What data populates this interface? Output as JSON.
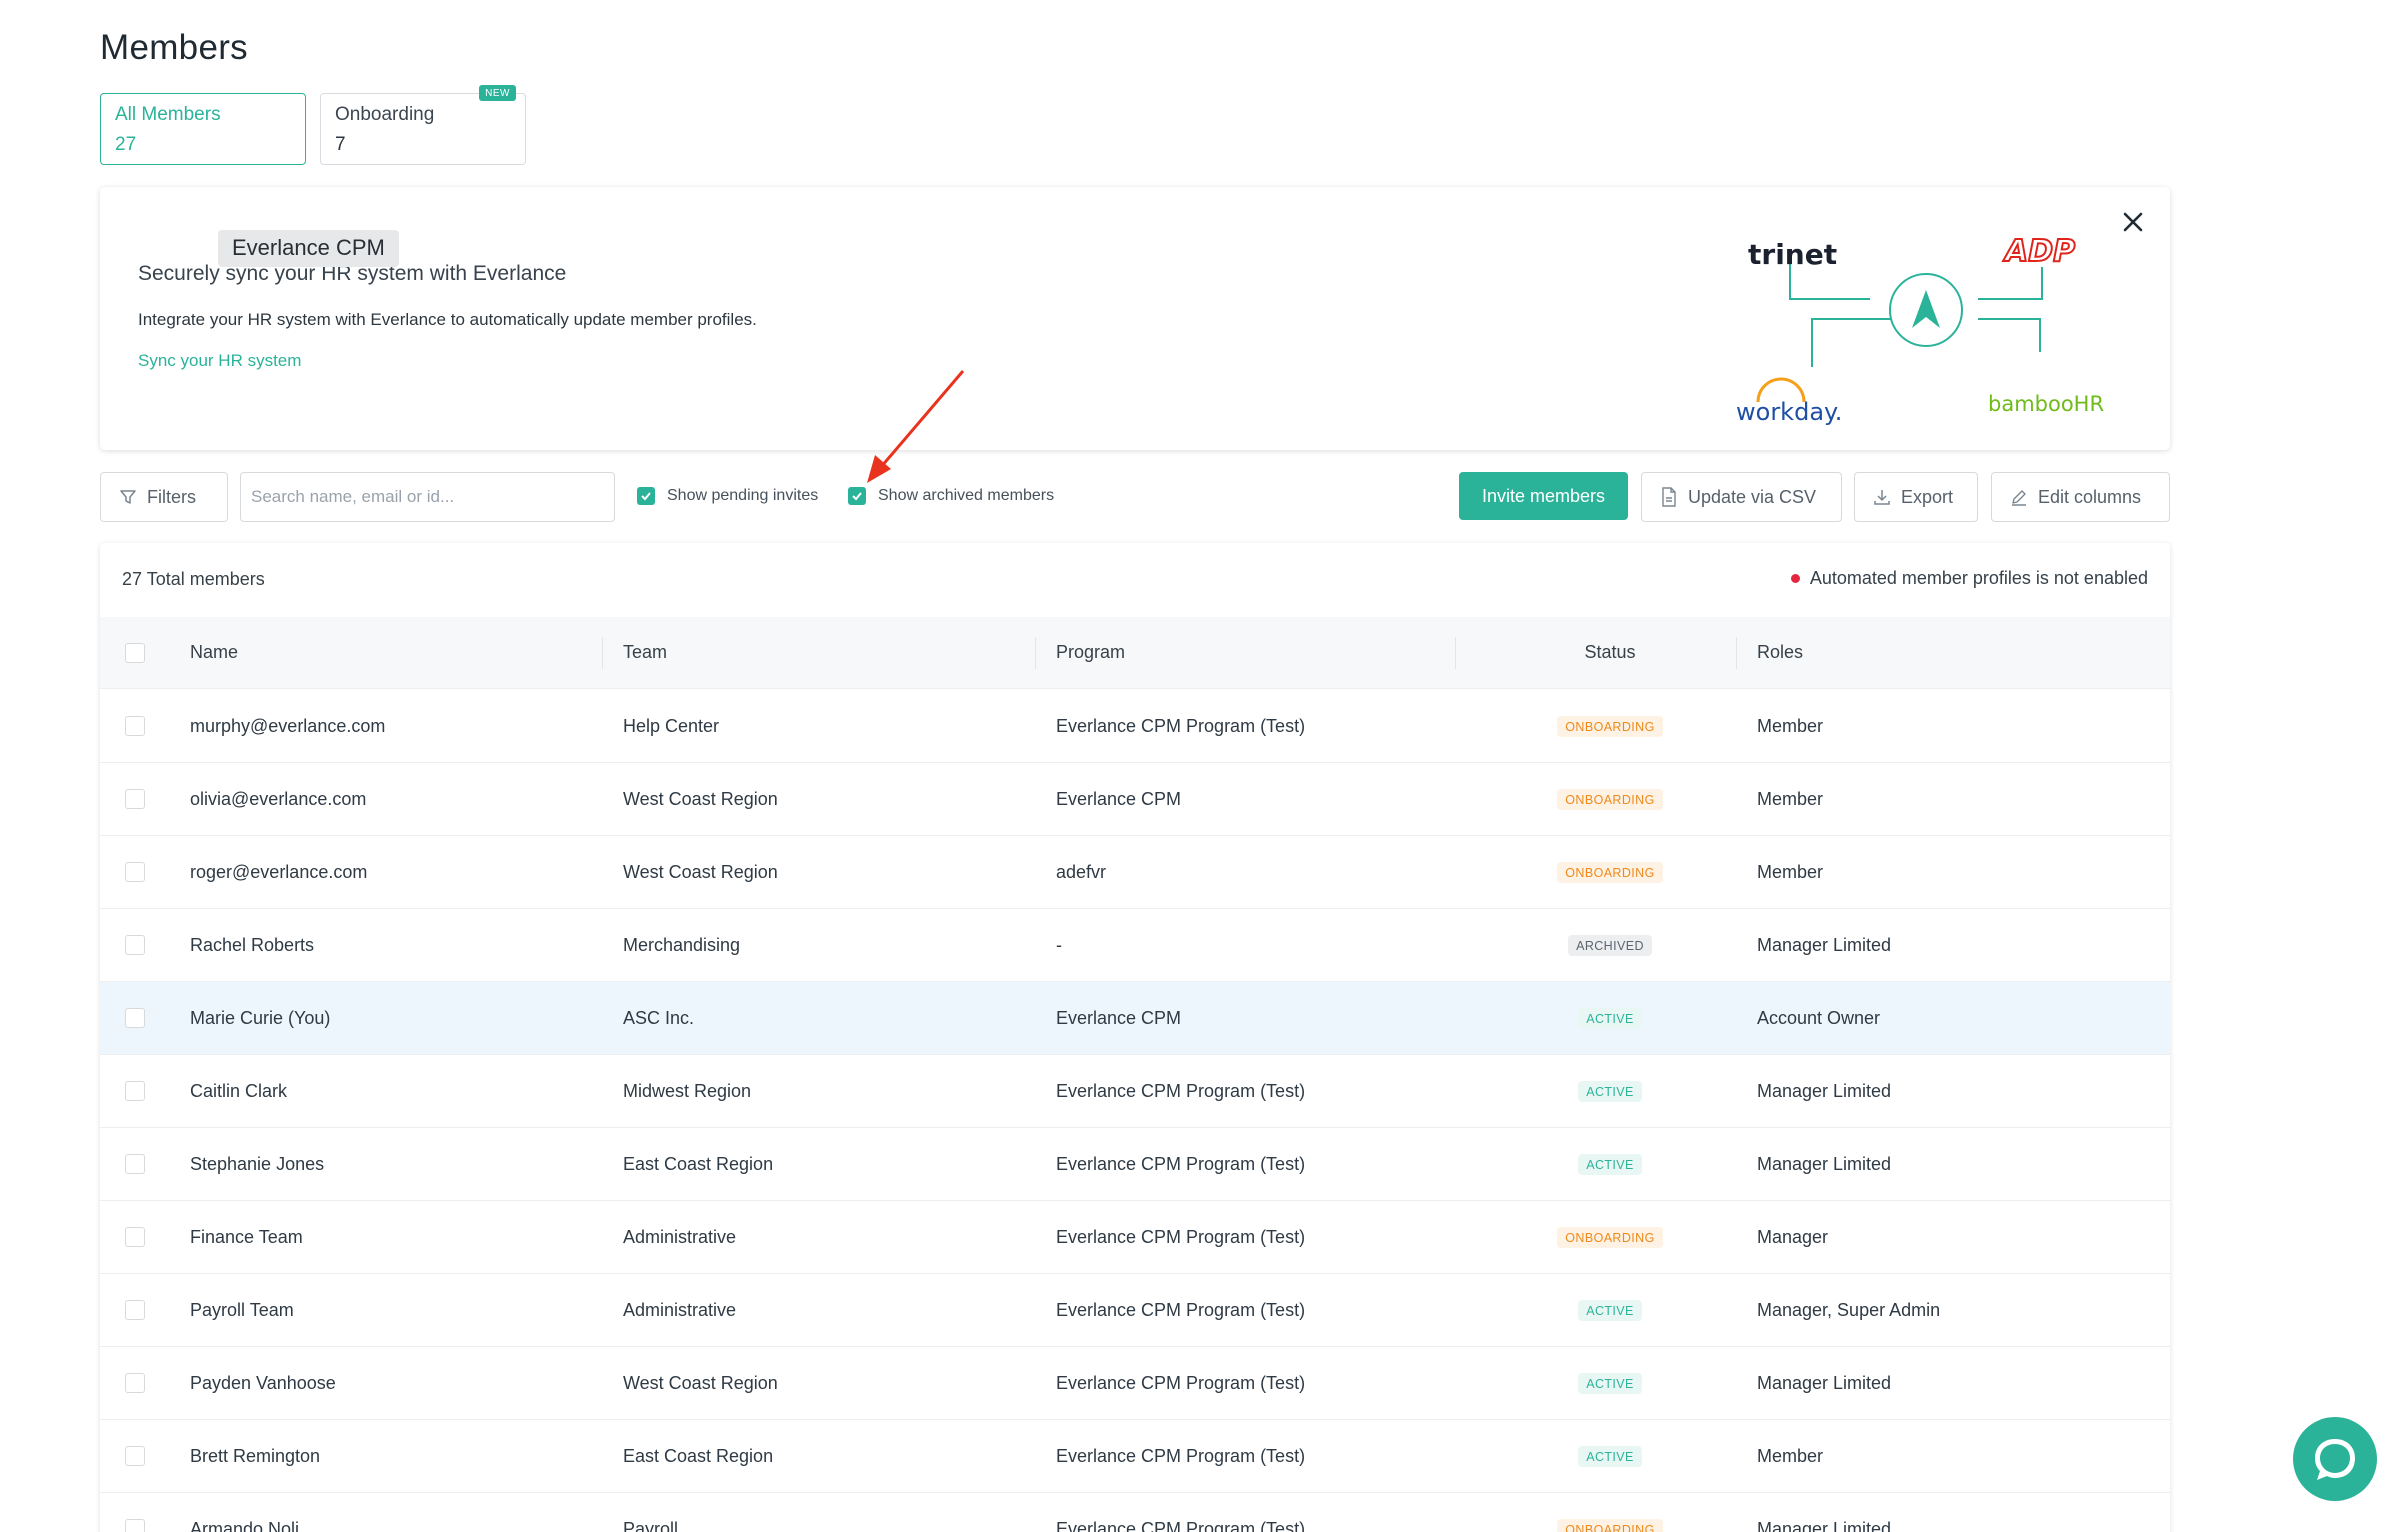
{
  "page": {
    "title": "Members"
  },
  "tabs": [
    {
      "label": "All Members",
      "count": "27"
    },
    {
      "label": "Onboarding",
      "count": "7",
      "badge": "NEW"
    }
  ],
  "banner": {
    "tooltip": "Everlance CPM",
    "title": "Securely sync your HR system with Everlance",
    "description": "Integrate your HR system with Everlance to automatically update member profiles.",
    "link": "Sync your HR system",
    "logos": {
      "trinet": "trinet",
      "adp": "ADP",
      "workday": "workday.",
      "bamboo": "bambooHR"
    }
  },
  "toolbar": {
    "filters_label": "Filters",
    "search_placeholder": "Search name, email or id...",
    "show_pending_label": "Show pending invites",
    "show_archived_label": "Show archived members",
    "invite_label": "Invite members",
    "csv_label": "Update via CSV",
    "export_label": "Export",
    "edit_columns_label": "Edit columns"
  },
  "table": {
    "total": "27 Total members",
    "notice": "Automated member profiles is not enabled",
    "headers": {
      "name": "Name",
      "team": "Team",
      "program": "Program",
      "status": "Status",
      "roles": "Roles"
    },
    "rows": [
      {
        "name": "murphy@everlance.com",
        "team": "Help Center",
        "program": "Everlance CPM Program (Test)",
        "status": "ONBOARDING",
        "roles": "Member"
      },
      {
        "name": "olivia@everlance.com",
        "team": "West Coast Region",
        "program": "Everlance CPM",
        "status": "ONBOARDING",
        "roles": "Member"
      },
      {
        "name": "roger@everlance.com",
        "team": "West Coast Region",
        "program": "adefvr",
        "status": "ONBOARDING",
        "roles": "Member"
      },
      {
        "name": "Rachel Roberts",
        "team": "Merchandising",
        "program": "-",
        "status": "ARCHIVED",
        "roles": "Manager Limited"
      },
      {
        "name": "Marie Curie (You)",
        "team": "ASC Inc.",
        "program": "Everlance CPM",
        "status": "ACTIVE",
        "roles": "Account Owner"
      },
      {
        "name": "Caitlin Clark",
        "team": "Midwest Region",
        "program": "Everlance CPM Program (Test)",
        "status": "ACTIVE",
        "roles": "Manager Limited"
      },
      {
        "name": "Stephanie Jones",
        "team": "East Coast Region",
        "program": "Everlance CPM Program (Test)",
        "status": "ACTIVE",
        "roles": "Manager Limited"
      },
      {
        "name": "Finance Team",
        "team": "Administrative",
        "program": "Everlance CPM Program (Test)",
        "status": "ONBOARDING",
        "roles": "Manager"
      },
      {
        "name": "Payroll Team",
        "team": "Administrative",
        "program": "Everlance CPM Program (Test)",
        "status": "ACTIVE",
        "roles": "Manager, Super Admin"
      },
      {
        "name": "Payden Vanhoose",
        "team": "West Coast Region",
        "program": "Everlance CPM Program (Test)",
        "status": "ACTIVE",
        "roles": "Manager Limited"
      },
      {
        "name": "Brett Remington",
        "team": "East Coast Region",
        "program": "Everlance CPM Program (Test)",
        "status": "ACTIVE",
        "roles": "Member"
      },
      {
        "name": "Armando Noli",
        "team": "Payroll",
        "program": "Everlance CPM Program (Test)",
        "status": "ONBOARDING",
        "roles": "Manager Limited"
      }
    ]
  },
  "colors": {
    "accent": "#2bb39a",
    "onboarding": "#ee8a1c",
    "notice_dot": "#e5263f",
    "highlight_row": "#eef6fd",
    "annotation_arrow": "#e8331f"
  },
  "icons": [
    "filter-icon",
    "check-icon",
    "file-icon",
    "download-icon",
    "pencil-icon",
    "close-icon",
    "chat-icon",
    "arrow-icon"
  ]
}
